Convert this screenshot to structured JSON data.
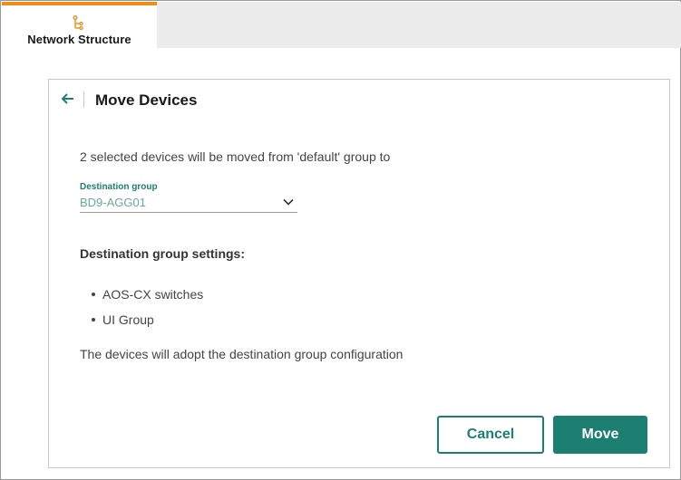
{
  "tab": {
    "label": "Network Structure",
    "icon": "hierarchy-icon",
    "accent_color": "#f28c17"
  },
  "dialog": {
    "title": "Move Devices",
    "back_icon": "arrow-left-icon",
    "intro_text": "2 selected devices will be moved from 'default' group to",
    "destination_field": {
      "label": "Destination group",
      "value": "BD9-AGG01"
    },
    "settings_heading": "Destination group settings:",
    "settings_items": [
      "AOS-CX switches",
      "UI Group"
    ],
    "adopt_note": "The devices will adopt the destination group configuration",
    "buttons": {
      "cancel": "Cancel",
      "move": "Move"
    },
    "primary_color": "#1c7f72"
  }
}
